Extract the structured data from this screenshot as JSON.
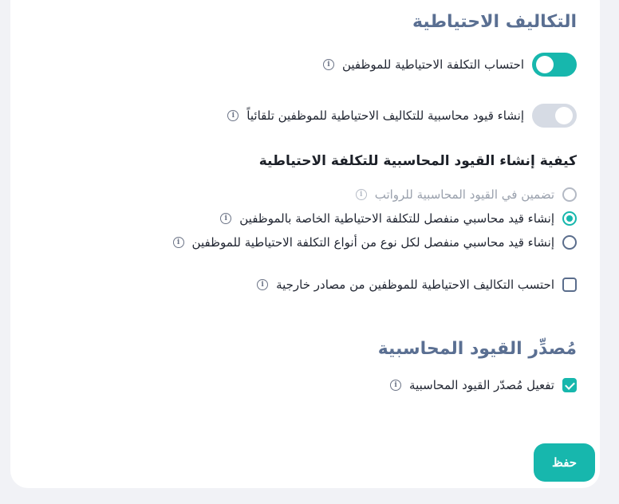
{
  "reserve_costs": {
    "title": "التكاليف الاحتياطية",
    "toggles": [
      {
        "label": "احتساب التكلفة الاحتياطية للموظفين",
        "state": "on"
      },
      {
        "label": "إنشاء قيود محاسبية للتكاليف الاحتياطية للموظفين تلقائياً",
        "state": "off"
      }
    ]
  },
  "entries_method": {
    "title": "كيفية إنشاء القيود المحاسبية للتكلفة الاحتياطية",
    "options": [
      {
        "label": "تضمين في القيود المحاسبية للرواتب",
        "state": "disabled"
      },
      {
        "label": "إنشاء قيد محاسبي منفصل للتكلفة الاحتياطية الخاصة بالموظفين",
        "state": "selected"
      },
      {
        "label": "إنشاء قيد محاسبي منفصل لكل نوع من أنواع التكلفة الاحتياطية للموظفين",
        "state": "unselected"
      }
    ],
    "external_checkbox": {
      "label": "احتسب التكاليف الاحتياطية للموظفين من مصادر خارجية",
      "checked": false
    }
  },
  "entries_source": {
    "title": "مُصدِّر القيود المحاسبية",
    "enable_checkbox": {
      "label": "تفعيل مُصدّر القيود المحاسبية",
      "checked": true
    }
  },
  "save_label": "حفظ",
  "colors": {
    "accent": "#17b7ad",
    "section_title": "#5a6f92",
    "toggle_off": "#d6dbe4"
  }
}
